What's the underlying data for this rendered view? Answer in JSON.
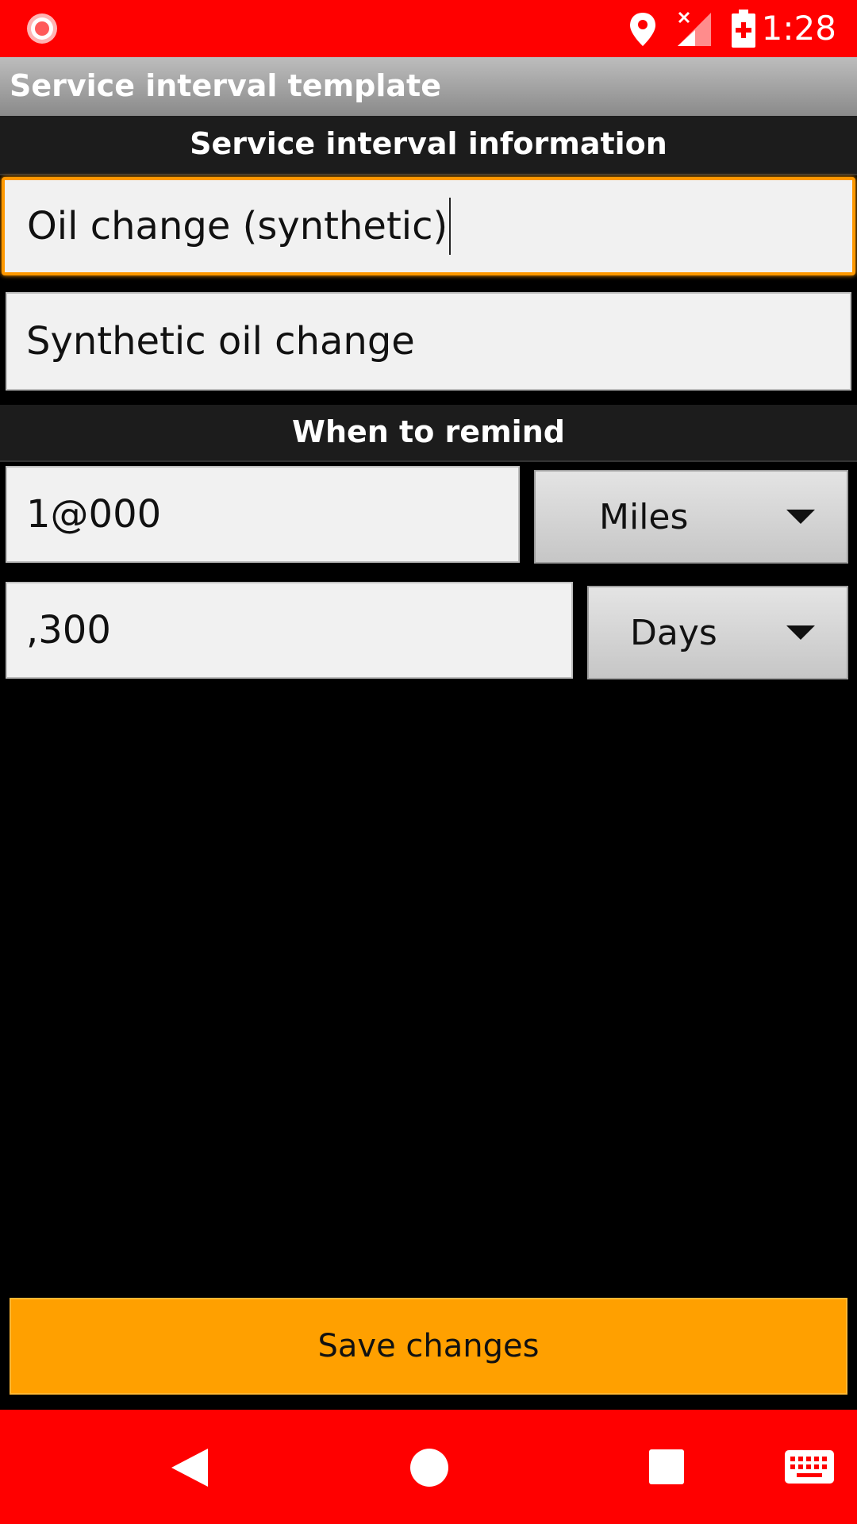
{
  "status_bar": {
    "time": "1:28",
    "icons": [
      "record-icon",
      "location-icon",
      "signal-icon",
      "battery-charging-icon"
    ],
    "background_color": "#ff0000"
  },
  "title_bar": {
    "title": "Service interval template"
  },
  "info_section": {
    "header": "Service interval information",
    "name_value": "Oil change (synthetic)",
    "description_value": "Synthetic oil change"
  },
  "remind_section": {
    "header": "When to remind",
    "distance_value": "1@000",
    "distance_unit": "Miles",
    "time_value": ",300",
    "time_unit": "Days"
  },
  "save_button": {
    "label": "Save changes",
    "color": "#ffa000"
  },
  "nav_bar": {
    "icons": [
      "back-icon",
      "home-icon",
      "recents-icon",
      "keyboard-icon"
    ],
    "background_color": "#ff0000"
  }
}
